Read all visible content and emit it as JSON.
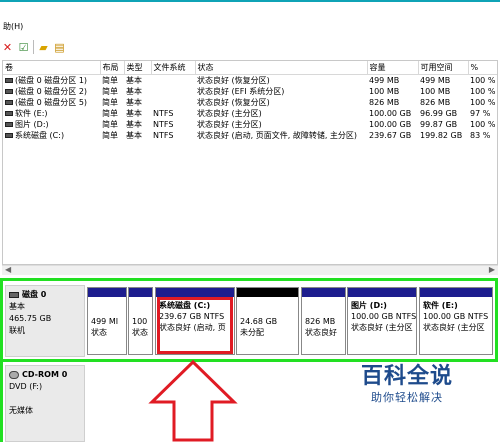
{
  "menu": {
    "help": "助(H)"
  },
  "toolbar": {
    "icons": [
      "close-red-x-icon",
      "check-doc-icon",
      "folder-up-icon",
      "properties-icon"
    ]
  },
  "table": {
    "headers": [
      "卷",
      "布局",
      "类型",
      "文件系统",
      "状态",
      "容量",
      "可用空间",
      "%"
    ],
    "rows": [
      [
        "(磁盘 0 磁盘分区 1)",
        "简单",
        "基本",
        "",
        "状态良好 (恢复分区)",
        "499 MB",
        "499 MB",
        "100 %"
      ],
      [
        "(磁盘 0 磁盘分区 2)",
        "简单",
        "基本",
        "",
        "状态良好 (EFI 系统分区)",
        "100 MB",
        "100 MB",
        "100 %"
      ],
      [
        "(磁盘 0 磁盘分区 5)",
        "简单",
        "基本",
        "",
        "状态良好 (恢复分区)",
        "826 MB",
        "826 MB",
        "100 %"
      ],
      [
        "软件 (E:)",
        "简单",
        "基本",
        "NTFS",
        "状态良好 (主分区)",
        "100.00 GB",
        "96.99 GB",
        "97 %"
      ],
      [
        "图片 (D:)",
        "简单",
        "基本",
        "NTFS",
        "状态良好 (主分区)",
        "100.00 GB",
        "99.87 GB",
        "100 %"
      ],
      [
        "系统磁盘 (C:)",
        "简单",
        "基本",
        "NTFS",
        "状态良好 (启动, 页面文件, 故障转储, 主分区)",
        "239.67 GB",
        "199.82 GB",
        "83 %"
      ]
    ]
  },
  "disk0": {
    "name": "磁盘 0",
    "type": "基本",
    "size": "465.75 GB",
    "status": "联机"
  },
  "partitions": [
    {
      "name": "",
      "line1": "499 MI",
      "line2": "状态"
    },
    {
      "name": "",
      "line1": "100",
      "line2": "状态"
    },
    {
      "name": "系统磁盘  (C:)",
      "line1": "239.67 GB NTFS",
      "line2": "状态良好 (启动, 页"
    },
    {
      "name": "",
      "line1": "24.68 GB",
      "line2": "未分配"
    },
    {
      "name": "",
      "line1": "826 MB",
      "line2": "状态良好"
    },
    {
      "name": "图片  (D:)",
      "line1": "100.00 GB NTFS",
      "line2": "状态良好 (主分区"
    },
    {
      "name": "软件  (E:)",
      "line1": "100.00 GB NTFS",
      "line2": "状态良好 (主分区"
    }
  ],
  "cdrom": {
    "name": "CD-ROM 0",
    "type": "DVD (F:)",
    "status": "无媒体"
  },
  "watermark": {
    "title": "百科全说",
    "subtitle": "助你轻松解决"
  },
  "colors": {
    "green_frame": "#22e022",
    "red_box": "#e01b24",
    "partition_bar": "#1d1d8e",
    "unallocated_bar": "#000000",
    "watermark": "#1e4b8c"
  }
}
